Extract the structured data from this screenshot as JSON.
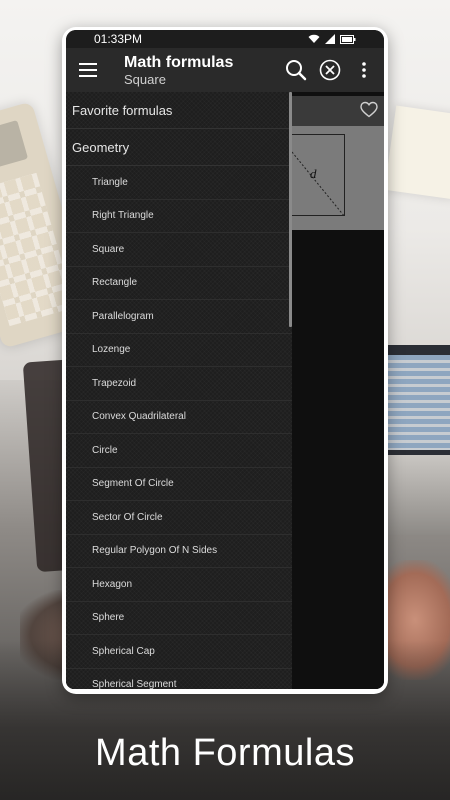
{
  "status_bar": {
    "time": "01:33PM",
    "icons": [
      "wifi-icon",
      "signal-icon",
      "battery-icon"
    ]
  },
  "app_bar": {
    "title": "Math formulas",
    "subtitle": "Square",
    "icons": [
      "hamburger-menu-icon",
      "search-icon",
      "close-circle-icon",
      "more-vert-icon"
    ]
  },
  "content": {
    "diagram_label": "d",
    "icons": [
      "heart-outline-icon"
    ]
  },
  "drawer": {
    "sections": [
      {
        "label": "Favorite formulas"
      },
      {
        "label": "Geometry"
      }
    ],
    "items": [
      "Triangle",
      "Right Triangle",
      "Square",
      "Rectangle",
      "Parallelogram",
      "Lozenge",
      "Trapezoid",
      "Convex Quadrilateral",
      "Circle",
      "Segment Of Circle",
      "Sector Of Circle",
      "Regular Polygon Of N Sides",
      "Hexagon",
      "Sphere",
      "Spherical Cap",
      "Spherical Segment"
    ]
  },
  "caption": "Math Formulas",
  "colors": {
    "appbar": "#2a2a2a",
    "drawer": "#1e1e1e",
    "phone_frame": "#ffffff"
  }
}
